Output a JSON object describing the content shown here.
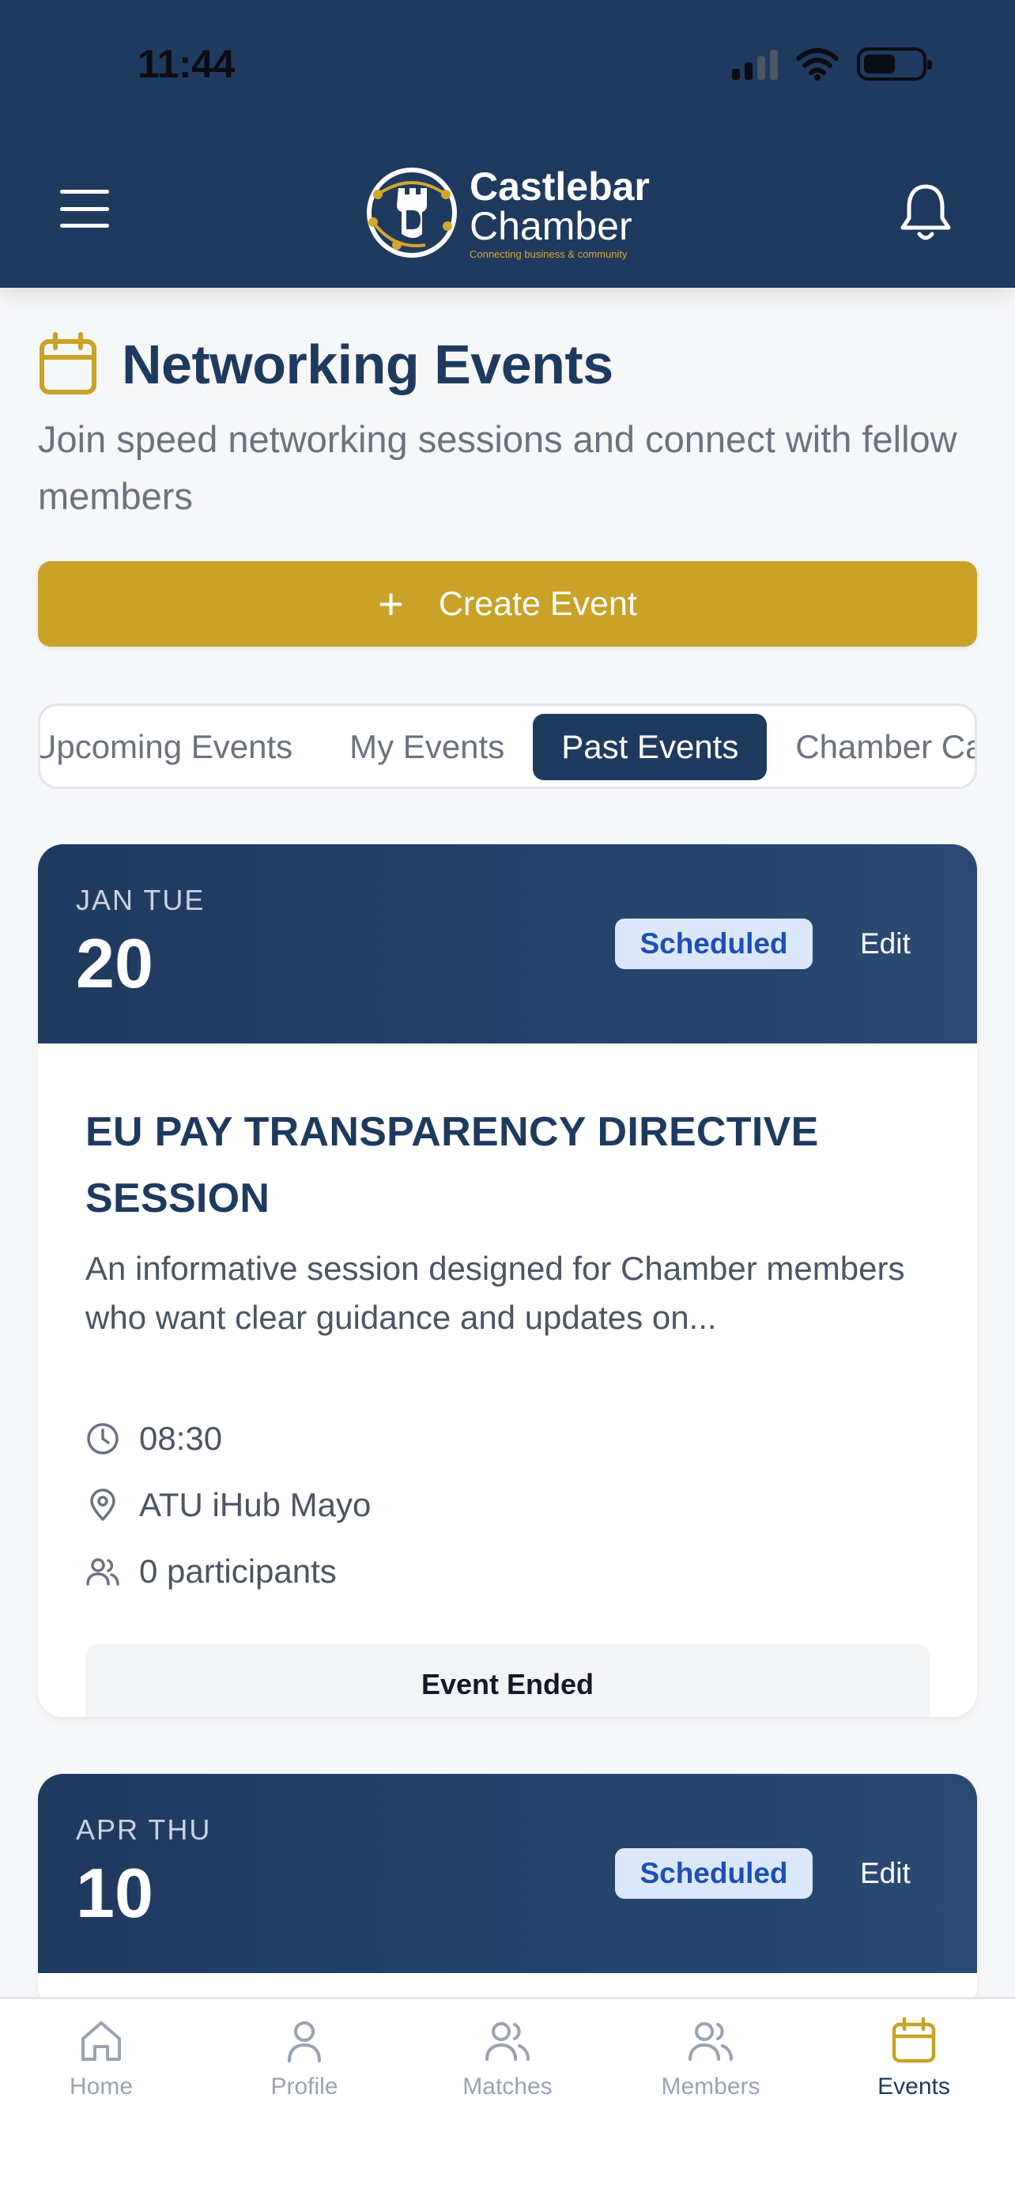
{
  "status_bar": {
    "time": "11:44"
  },
  "header": {
    "logo_line1": "Castlebar",
    "logo_line2": "Chamber",
    "logo_tagline": "Connecting business & community"
  },
  "page": {
    "title": "Networking Events",
    "subtitle": "Join speed networking sessions and connect with fellow members",
    "create_label": "Create Event"
  },
  "tabs": [
    {
      "label": "Upcoming Events",
      "active": false
    },
    {
      "label": "My Events",
      "active": false
    },
    {
      "label": "Past Events",
      "active": true
    },
    {
      "label": "Chamber Calendar",
      "active": false
    }
  ],
  "events": [
    {
      "month_day": "JAN TUE",
      "date": "20",
      "status": "Scheduled",
      "edit_label": "Edit",
      "title": "EU PAY TRANSPARENCY DIRECTIVE SESSION",
      "description": "An informative session designed for Chamber members who want clear guidance and updates on...",
      "time": "08:30",
      "location": "ATU iHub Mayo",
      "participants": "0 participants",
      "action_label": "Event Ended"
    },
    {
      "month_day": "APR THU",
      "date": "10",
      "status": "Scheduled",
      "edit_label": "Edit"
    }
  ],
  "nav": {
    "home": "Home",
    "profile": "Profile",
    "matches": "Matches",
    "members": "Members",
    "events": "Events",
    "active": "events"
  },
  "colors": {
    "primary": "#1f3a5f",
    "accent": "#c9a227",
    "badge_bg": "#dbe7fb",
    "badge_text": "#1e4fb8"
  }
}
